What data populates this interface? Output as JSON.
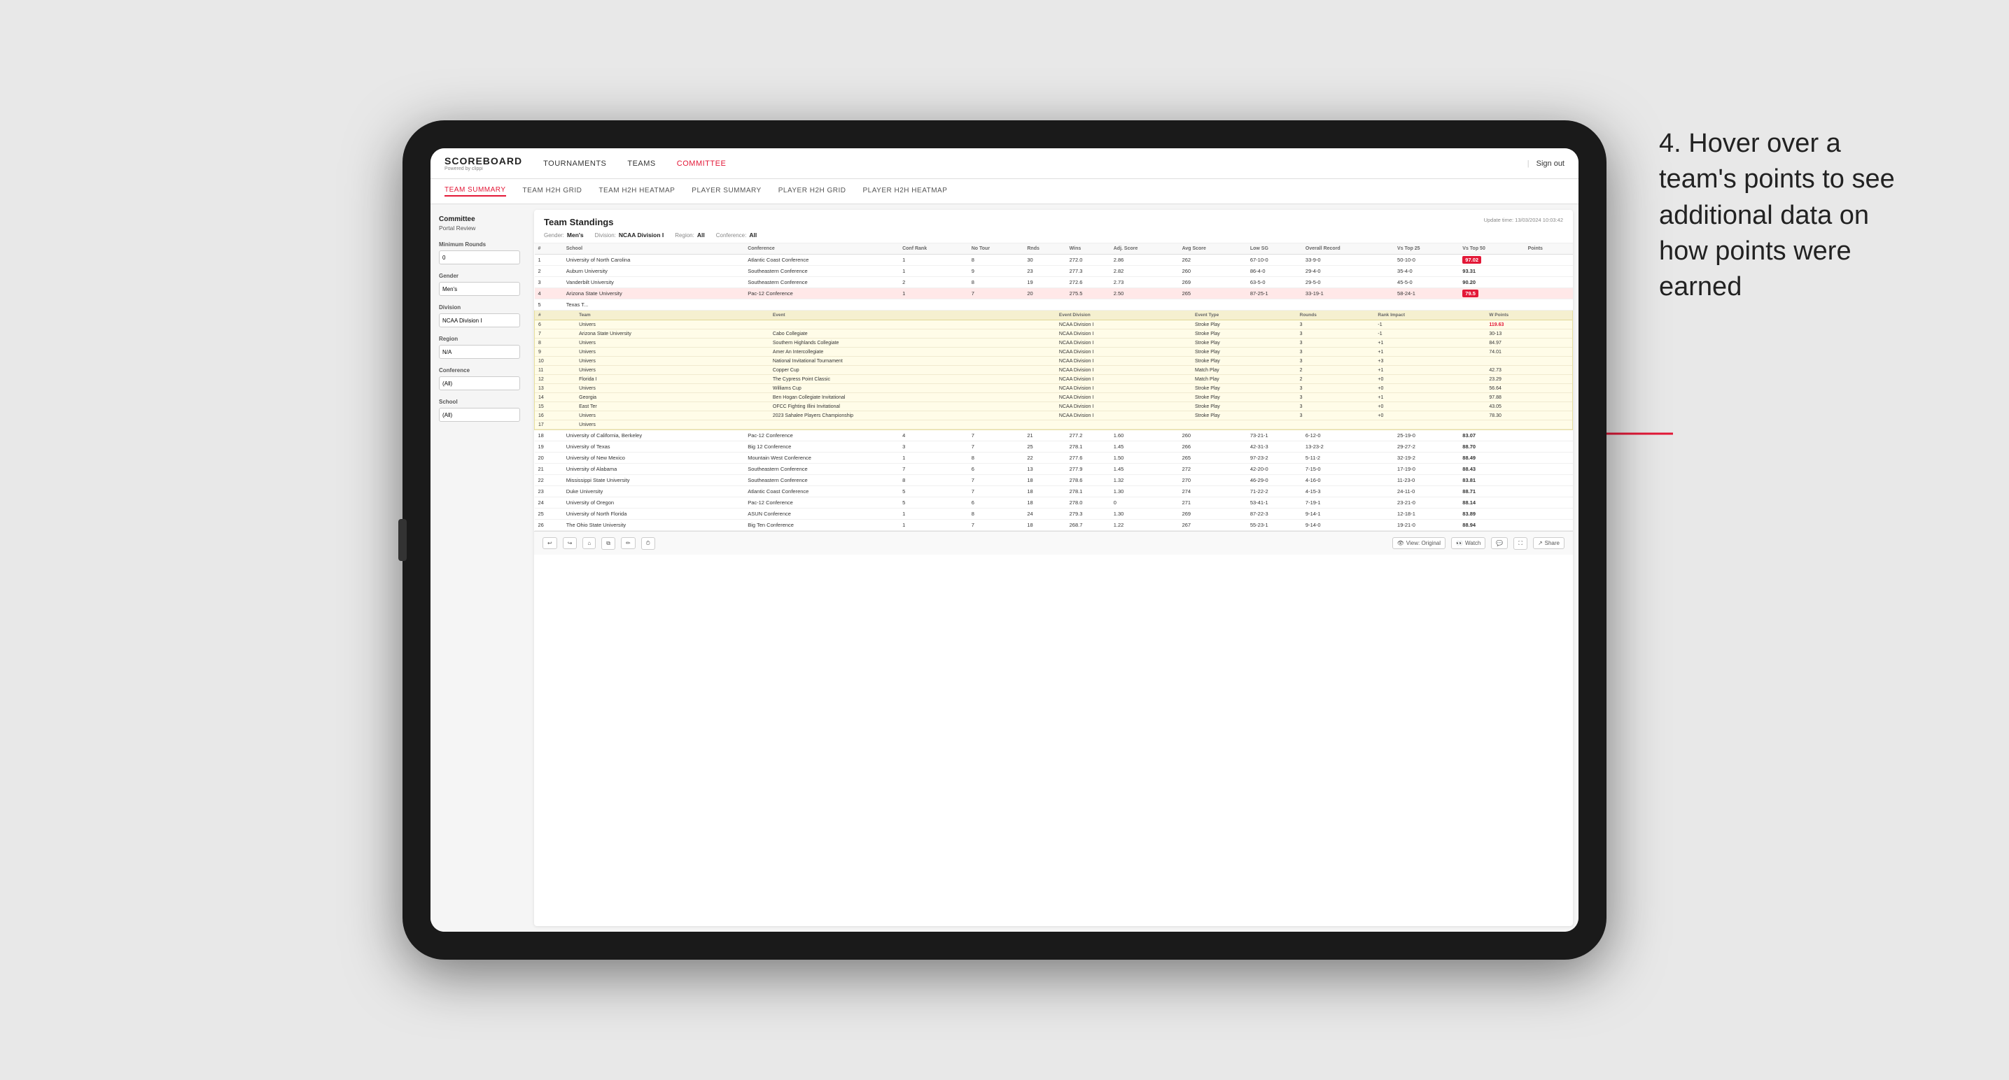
{
  "app": {
    "logo": "SCOREBOARD",
    "logo_sub": "Powered by clippi",
    "sign_out": "Sign out"
  },
  "top_nav": {
    "links": [
      "TOURNAMENTS",
      "TEAMS",
      "COMMITTEE"
    ]
  },
  "sub_nav": {
    "links": [
      "TEAM SUMMARY",
      "TEAM H2H GRID",
      "TEAM H2H HEATMAP",
      "PLAYER SUMMARY",
      "PLAYER H2H GRID",
      "PLAYER H2H HEATMAP"
    ],
    "active": "TEAM SUMMARY"
  },
  "sidebar": {
    "title": "Committee",
    "subtitle": "Portal Review",
    "sections": [
      {
        "label": "Minimum Rounds",
        "type": "input",
        "value": "0"
      },
      {
        "label": "Gender",
        "type": "select",
        "value": "Men's"
      },
      {
        "label": "Division",
        "type": "select",
        "value": "NCAA Division I"
      },
      {
        "label": "Region",
        "type": "select",
        "value": "N/A"
      },
      {
        "label": "Conference",
        "type": "select",
        "value": "(All)"
      },
      {
        "label": "School",
        "type": "select",
        "value": "(All)"
      }
    ]
  },
  "standings": {
    "title": "Team Standings",
    "update_time": "Update time: 13/03/2024 10:03:42",
    "filters": {
      "gender": "Men's",
      "division_label": "Division:",
      "division": "NCAA Division I",
      "region_label": "Region:",
      "region": "All",
      "conference_label": "Conference:",
      "conference": "All"
    },
    "columns": [
      "#",
      "School",
      "Conference",
      "Conf Rank",
      "No Tour",
      "Rnds",
      "Wins",
      "Adj Score",
      "Avg Score",
      "Low SG",
      "Overall Record",
      "Vs Top 25",
      "Vs Top 50",
      "Points"
    ],
    "rows": [
      {
        "rank": 1,
        "school": "University of North Carolina",
        "conference": "Atlantic Coast Conference",
        "conf_rank": 1,
        "no_tour": 8,
        "rnds": 30,
        "wins": 272.0,
        "adj": 2.86,
        "avg": 262,
        "low": "67-10-0",
        "overall": "33-9-0",
        "vs25": "50-10-0",
        "vs50": "97.02",
        "points_highlight": true
      },
      {
        "rank": 2,
        "school": "Auburn University",
        "conference": "Southeastern Conference",
        "conf_rank": 1,
        "no_tour": 9,
        "rnds": 23,
        "wins": 277.3,
        "adj": 2.82,
        "avg": 260,
        "low": "86-4-0",
        "overall": "29-4-0",
        "vs25": "35-4-0",
        "vs50": "93.31",
        "points_highlight": false
      },
      {
        "rank": 3,
        "school": "Vanderbilt University",
        "conference": "Southeastern Conference",
        "conf_rank": 2,
        "no_tour": 8,
        "rnds": 19,
        "wins": 272.6,
        "adj": 2.73,
        "avg": 269,
        "low": "63-5-0",
        "overall": "29-5-0",
        "vs25": "45-5-0",
        "vs50": "90.20",
        "points_highlight": false
      },
      {
        "rank": 4,
        "school": "Arizona State University",
        "conference": "Pac-12 Conference",
        "conf_rank": 1,
        "no_tour": 7,
        "rnds": 20,
        "wins": 275.5,
        "adj": 2.5,
        "avg": 265,
        "low": "87-25-1",
        "overall": "33-19-1",
        "vs25": "58-24-1",
        "vs50": "79.5",
        "points_highlight": true
      },
      {
        "rank": 5,
        "school": "Texas T...",
        "conference": "",
        "conf_rank": "",
        "no_tour": "",
        "rnds": "",
        "wins": "",
        "adj": "",
        "avg": "",
        "low": "",
        "overall": "",
        "vs25": "",
        "vs50": "",
        "points_highlight": false
      }
    ],
    "tooltip_rows": [
      {
        "num": 6,
        "team": "Univers",
        "event": "",
        "event_division": "NCAA Division I",
        "event_type": "Stroke Play",
        "rounds": 3,
        "rank_impact": "-1",
        "points": "119.63"
      },
      {
        "num": 7,
        "team": "Arizona State University",
        "event": "Cabo Collegiate",
        "event_division": "NCAA Division I",
        "event_type": "Stroke Play",
        "rounds": 3,
        "rank_impact": "-1",
        "points": "30-13"
      },
      {
        "num": 8,
        "team": "Univers",
        "event": "Southern Highlands Collegiate",
        "event_division": "NCAA Division I",
        "event_type": "Stroke Play",
        "rounds": 3,
        "rank_impact": "+1",
        "points": "84.97"
      },
      {
        "num": 9,
        "team": "Univers",
        "event": "Amer An Intercollegiate",
        "event_division": "NCAA Division I",
        "event_type": "Stroke Play",
        "rounds": 3,
        "rank_impact": "+1",
        "points": "74.01"
      },
      {
        "num": 10,
        "team": "Univers",
        "event": "National Invitational Tournament",
        "event_division": "NCAA Division I",
        "event_type": "Stroke Play",
        "rounds": 3,
        "rank_impact": "+3",
        "points": ""
      },
      {
        "num": 11,
        "team": "Univers",
        "event": "Copper Cup",
        "event_division": "NCAA Division I",
        "event_type": "Match Play",
        "rounds": 2,
        "rank_impact": "+1",
        "points": "42.73"
      },
      {
        "num": 12,
        "team": "Florida I",
        "event": "The Cypress Point Classic",
        "event_division": "NCAA Division I",
        "event_type": "Match Play",
        "rounds": 2,
        "rank_impact": "+0",
        "points": "23.29"
      },
      {
        "num": 13,
        "team": "Univers",
        "event": "Williams Cup",
        "event_division": "NCAA Division I",
        "event_type": "Stroke Play",
        "rounds": 3,
        "rank_impact": "+0",
        "points": "56.64"
      },
      {
        "num": 14,
        "team": "Georgia",
        "event": "Ben Hogan Collegiate Invitational",
        "event_division": "NCAA Division I",
        "event_type": "Stroke Play",
        "rounds": 3,
        "rank_impact": "+1",
        "points": "97.88"
      },
      {
        "num": 15,
        "team": "East Ter",
        "event": "OFCC Fighting Illini Invitational",
        "event_division": "NCAA Division I",
        "event_type": "Stroke Play",
        "rounds": 3,
        "rank_impact": "+0",
        "points": "43.05"
      },
      {
        "num": 16,
        "team": "Univers",
        "event": "2023 Sahalee Players Championship",
        "event_division": "NCAA Division I",
        "event_type": "Stroke Play",
        "rounds": 3,
        "rank_impact": "+0",
        "points": "78.30"
      },
      {
        "num": 17,
        "team": "Univers",
        "event": "",
        "event_division": "",
        "event_type": "",
        "rounds": "",
        "rank_impact": "",
        "points": ""
      }
    ],
    "lower_rows": [
      {
        "rank": 18,
        "school": "University of California, Berkeley",
        "conference": "Pac-12 Conference",
        "conf_rank": 4,
        "no_tour": 7,
        "rnds": 21,
        "wins": 277.2,
        "adj": 1.6,
        "avg": 260,
        "low": "73-21-1",
        "overall": "6-12-0",
        "vs25": "25-19-0",
        "vs50": "83.07"
      },
      {
        "rank": 19,
        "school": "University of Texas",
        "conference": "Big 12 Conference",
        "conf_rank": 3,
        "no_tour": 7,
        "rnds": 25,
        "wins": 278.1,
        "adj": 1.45,
        "avg": 266,
        "low": "42-31-3",
        "overall": "13-23-2",
        "vs25": "29-27-2",
        "vs50": "88.70"
      },
      {
        "rank": 20,
        "school": "University of New Mexico",
        "conference": "Mountain West Conference",
        "conf_rank": 1,
        "no_tour": 8,
        "rnds": 22,
        "wins": 277.6,
        "adj": 1.5,
        "avg": 265,
        "low": "97-23-2",
        "overall": "5-11-2",
        "vs25": "32-19-2",
        "vs50": "88.49"
      },
      {
        "rank": 21,
        "school": "University of Alabama",
        "conference": "Southeastern Conference",
        "conf_rank": 7,
        "no_tour": 6,
        "rnds": 13,
        "wins": 277.9,
        "adj": 1.45,
        "avg": 272,
        "low": "42-20-0",
        "overall": "7-15-0",
        "vs25": "17-19-0",
        "vs50": "88.43"
      },
      {
        "rank": 22,
        "school": "Mississippi State University",
        "conference": "Southeastern Conference",
        "conf_rank": 8,
        "no_tour": 7,
        "rnds": 18,
        "wins": 278.6,
        "adj": 1.32,
        "avg": 270,
        "low": "46-29-0",
        "overall": "4-16-0",
        "vs25": "11-23-0",
        "vs50": "83.81"
      },
      {
        "rank": 23,
        "school": "Duke University",
        "conference": "Atlantic Coast Conference",
        "conf_rank": 5,
        "no_tour": 7,
        "rnds": 18,
        "wins": 278.1,
        "adj": 1.3,
        "avg": 274,
        "low": "71-22-2",
        "overall": "4-15-3",
        "vs25": "24-11-0",
        "vs50": "88.71"
      },
      {
        "rank": 24,
        "school": "University of Oregon",
        "conference": "Pac-12 Conference",
        "conf_rank": 5,
        "no_tour": 6,
        "rnds": 18,
        "wins": 278.0,
        "adj": 0,
        "avg": 271,
        "low": "53-41-1",
        "overall": "7-19-1",
        "vs25": "23-21-0",
        "vs50": "88.14"
      },
      {
        "rank": 25,
        "school": "University of North Florida",
        "conference": "ASUN Conference",
        "conf_rank": 1,
        "no_tour": 8,
        "rnds": 24,
        "wins": 279.3,
        "adj": 1.3,
        "avg": 269,
        "low": "87-22-3",
        "overall": "9-14-1",
        "vs25": "12-18-1",
        "vs50": "83.89"
      },
      {
        "rank": 26,
        "school": "The Ohio State University",
        "conference": "Big Ten Conference",
        "conf_rank": 1,
        "no_tour": 7,
        "rnds": 18,
        "wins": 268.7,
        "adj": 1.22,
        "avg": 267,
        "low": "55-23-1",
        "overall": "9-14-0",
        "vs25": "19-21-0",
        "vs50": "88.94"
      }
    ]
  },
  "toolbar": {
    "undo": "↩",
    "redo": "↪",
    "home": "⌂",
    "copy": "⧉",
    "draw": "✏",
    "clock": "⏱",
    "view_label": "View: Original",
    "watch": "Watch",
    "share": "Share"
  },
  "annotation": {
    "text": "4. Hover over a team's points to see additional data on how points were earned"
  }
}
